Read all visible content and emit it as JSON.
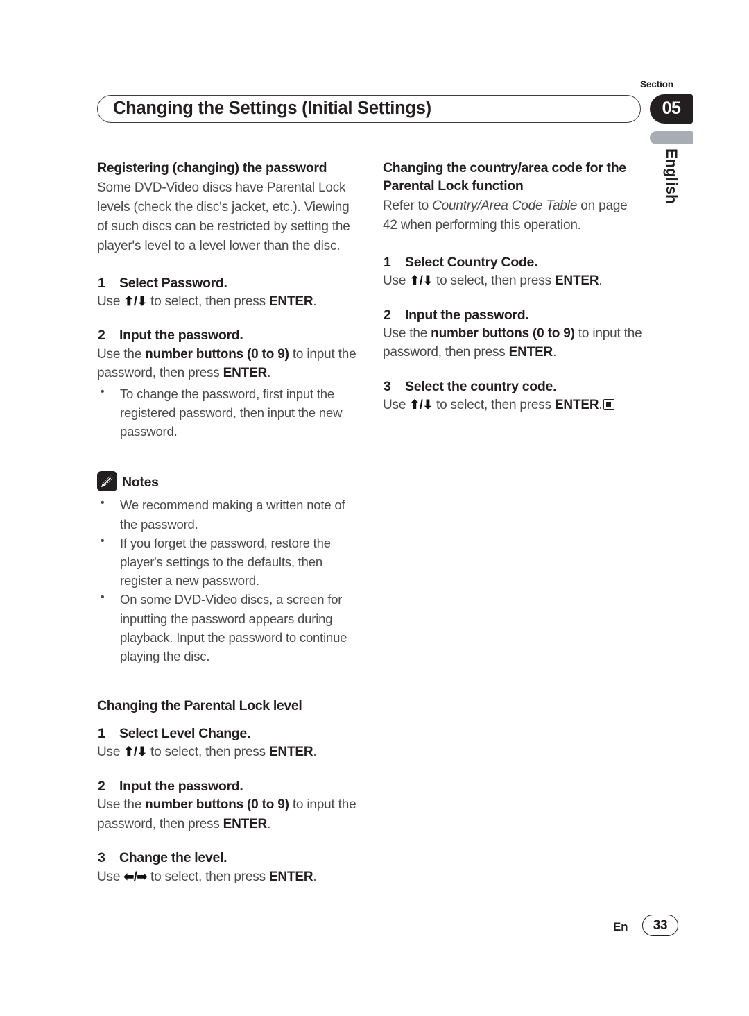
{
  "header": {
    "title": "Changing the Settings (Initial Settings)",
    "section_label": "Section",
    "section_number": "05",
    "language": "English"
  },
  "left_column": {
    "section1": {
      "heading": "Registering (changing) the password",
      "intro": "Some DVD-Video discs have Parental Lock levels (check the disc's jacket, etc.). Viewing of such discs can be restricted by setting the player's level to a level lower than the disc.",
      "steps": [
        {
          "num": "1",
          "label": "Select Password.",
          "body_pre": "Use ",
          "arrows": "⬆/⬇",
          "body_mid": " to select, then press ",
          "body_bold": "ENTER",
          "body_post": "."
        },
        {
          "num": "2",
          "label": "Input the password.",
          "body_pre": "Use the ",
          "body_bold1": "number buttons (0 to 9)",
          "body_mid": " to input the password, then press ",
          "body_bold2": "ENTER",
          "body_post": ".",
          "bullets": [
            "To change the password, first input the registered password, then input the new password."
          ]
        }
      ]
    },
    "notes": {
      "icon": "pencil-note-icon",
      "title": "Notes",
      "items": [
        "We recommend making a written note of the password.",
        "If you forget the password, restore the player's settings to the defaults, then register a new password.",
        "On some DVD-Video discs, a screen for inputting the password appears during playback. Input the password to continue playing the disc."
      ]
    },
    "section2": {
      "heading": "Changing the Parental Lock level",
      "steps": [
        {
          "num": "1",
          "label": "Select Level Change.",
          "body_pre": "Use ",
          "arrows": "⬆/⬇",
          "body_mid": " to select, then press ",
          "body_bold": "ENTER",
          "body_post": "."
        },
        {
          "num": "2",
          "label": "Input the password.",
          "body_pre": "Use the ",
          "body_bold1": "number buttons (0 to 9)",
          "body_mid": " to input the password, then press ",
          "body_bold2": "ENTER",
          "body_post": "."
        },
        {
          "num": "3",
          "label": "Change the level.",
          "body_pre": "Use ",
          "arrows": "⬅/➡",
          "body_mid": " to select, then press ",
          "body_bold": "ENTER",
          "body_post": "."
        }
      ]
    }
  },
  "right_column": {
    "section1": {
      "heading": "Changing the country/area code for the Parental Lock function",
      "intro_pre": "Refer to ",
      "intro_italic": "Country/Area Code Table",
      "intro_post": " on page 42 when performing this operation.",
      "steps": [
        {
          "num": "1",
          "label": "Select Country Code.",
          "body_pre": "Use ",
          "arrows": "⬆/⬇",
          "body_mid": " to select, then press ",
          "body_bold": "ENTER",
          "body_post": "."
        },
        {
          "num": "2",
          "label": "Input the password.",
          "body_pre": "Use the ",
          "body_bold1": "number buttons (0 to 9)",
          "body_mid": " to input the password, then press ",
          "body_bold2": "ENTER",
          "body_post": "."
        },
        {
          "num": "3",
          "label": "Select the country code.",
          "body_pre": "Use ",
          "arrows": "⬆/⬇",
          "body_mid": " to select, then press ",
          "body_bold": "ENTER",
          "body_post": ".",
          "end_marker": true
        }
      ]
    }
  },
  "footer": {
    "language_code": "En",
    "page_number": "33"
  }
}
